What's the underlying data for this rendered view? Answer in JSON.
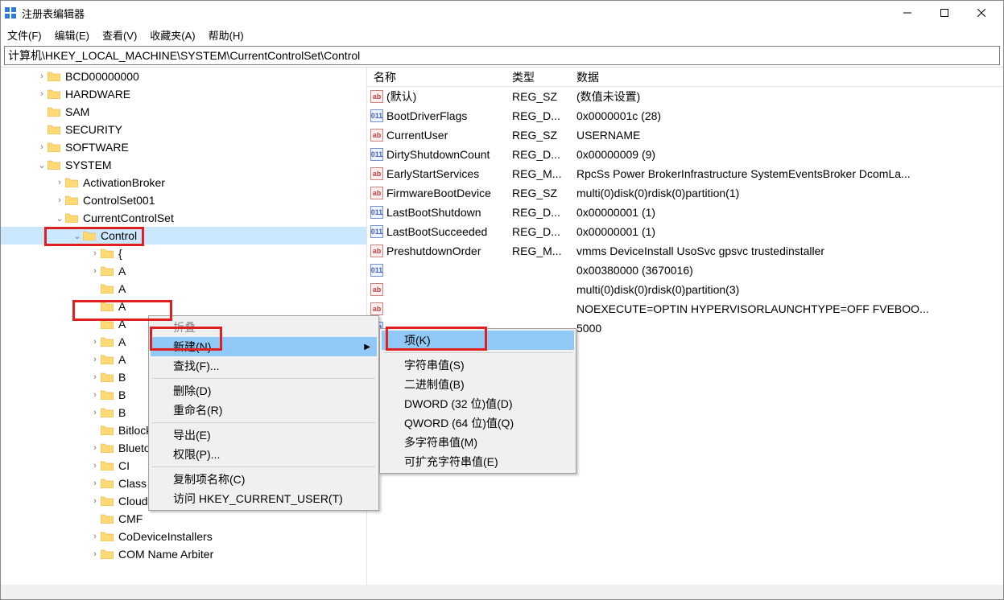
{
  "window": {
    "title": "注册表编辑器",
    "menu": {
      "file": "文件(F)",
      "edit": "编辑(E)",
      "view": "查看(V)",
      "favorites": "收藏夹(A)",
      "help": "帮助(H)"
    },
    "address": "计算机\\HKEY_LOCAL_MACHINE\\SYSTEM\\CurrentControlSet\\Control"
  },
  "tree": {
    "roots": [
      {
        "indent": 2,
        "chev": ">",
        "label": "BCD00000000"
      },
      {
        "indent": 2,
        "chev": ">",
        "label": "HARDWARE"
      },
      {
        "indent": 2,
        "chev": "",
        "label": "SAM"
      },
      {
        "indent": 2,
        "chev": "",
        "label": "SECURITY"
      },
      {
        "indent": 2,
        "chev": ">",
        "label": "SOFTWARE"
      },
      {
        "indent": 2,
        "chev": "v",
        "label": "SYSTEM"
      },
      {
        "indent": 3,
        "chev": ">",
        "label": "ActivationBroker"
      },
      {
        "indent": 3,
        "chev": ">",
        "label": "ControlSet001"
      },
      {
        "indent": 3,
        "chev": "v",
        "label": "CurrentControlSet"
      },
      {
        "indent": 4,
        "chev": "v",
        "label": "Control",
        "selected": true
      },
      {
        "indent": 5,
        "chev": ">",
        "label": "{"
      },
      {
        "indent": 5,
        "chev": ">",
        "label": "A"
      },
      {
        "indent": 5,
        "chev": "",
        "label": "A"
      },
      {
        "indent": 5,
        "chev": "",
        "label": "A"
      },
      {
        "indent": 5,
        "chev": "",
        "label": "A"
      },
      {
        "indent": 5,
        "chev": ">",
        "label": "A"
      },
      {
        "indent": 5,
        "chev": ">",
        "label": "A"
      },
      {
        "indent": 5,
        "chev": ">",
        "label": "B"
      },
      {
        "indent": 5,
        "chev": ">",
        "label": "B"
      },
      {
        "indent": 5,
        "chev": ">",
        "label": "B"
      },
      {
        "indent": 5,
        "chev": "",
        "label": "BitlockerStatus"
      },
      {
        "indent": 5,
        "chev": ">",
        "label": "Bluetooth"
      },
      {
        "indent": 5,
        "chev": ">",
        "label": "CI"
      },
      {
        "indent": 5,
        "chev": ">",
        "label": "Class"
      },
      {
        "indent": 5,
        "chev": ">",
        "label": "CloudDomainJoin"
      },
      {
        "indent": 5,
        "chev": "",
        "label": "CMF"
      },
      {
        "indent": 5,
        "chev": ">",
        "label": "CoDeviceInstallers"
      },
      {
        "indent": 5,
        "chev": ">",
        "label": "COM Name Arbiter"
      }
    ]
  },
  "detail": {
    "header": {
      "name": "名称",
      "type": "类型",
      "data": "数据"
    },
    "rows": [
      {
        "icon": "sz",
        "name": "(默认)",
        "type": "REG_SZ",
        "data": "(数值未设置)"
      },
      {
        "icon": "bin",
        "name": "BootDriverFlags",
        "type": "REG_D...",
        "data": "0x0000001c (28)"
      },
      {
        "icon": "sz",
        "name": "CurrentUser",
        "type": "REG_SZ",
        "data": "USERNAME"
      },
      {
        "icon": "bin",
        "name": "DirtyShutdownCount",
        "type": "REG_D...",
        "data": "0x00000009 (9)"
      },
      {
        "icon": "sz",
        "name": "EarlyStartServices",
        "type": "REG_M...",
        "data": "RpcSs Power BrokerInfrastructure SystemEventsBroker DcomLa..."
      },
      {
        "icon": "sz",
        "name": "FirmwareBootDevice",
        "type": "REG_SZ",
        "data": "multi(0)disk(0)rdisk(0)partition(1)"
      },
      {
        "icon": "bin",
        "name": "LastBootShutdown",
        "type": "REG_D...",
        "data": "0x00000001 (1)"
      },
      {
        "icon": "bin",
        "name": "LastBootSucceeded",
        "type": "REG_D...",
        "data": "0x00000001 (1)"
      },
      {
        "icon": "sz",
        "name": "PreshutdownOrder",
        "type": "REG_M...",
        "data": "vmms DeviceInstall UsoSvc gpsvc trustedinstaller"
      },
      {
        "icon": "bin",
        "name": "",
        "type": "",
        "data": "0x00380000 (3670016)"
      },
      {
        "icon": "sz",
        "name": "",
        "type": "",
        "data": "multi(0)disk(0)rdisk(0)partition(3)"
      },
      {
        "icon": "sz",
        "name": "",
        "type": "",
        "data": " NOEXECUTE=OPTIN  HYPERVISORLAUNCHTYPE=OFF  FVEBOO..."
      },
      {
        "icon": "bin",
        "name": "",
        "type": "",
        "data": "5000"
      }
    ]
  },
  "ctx": {
    "collapse": "折叠",
    "new": "新建(N)",
    "find": "查找(F)...",
    "delete": "删除(D)",
    "rename": "重命名(R)",
    "export": "导出(E)",
    "permissions": "权限(P)...",
    "copyname": "复制项名称(C)",
    "goto": "访问 HKEY_CURRENT_USER(T)"
  },
  "subctx": {
    "key": "项(K)",
    "string": "字符串值(S)",
    "binary": "二进制值(B)",
    "dword": "DWORD (32 位)值(D)",
    "qword": "QWORD (64 位)值(Q)",
    "multi": "多字符串值(M)",
    "expand": "可扩充字符串值(E)"
  }
}
